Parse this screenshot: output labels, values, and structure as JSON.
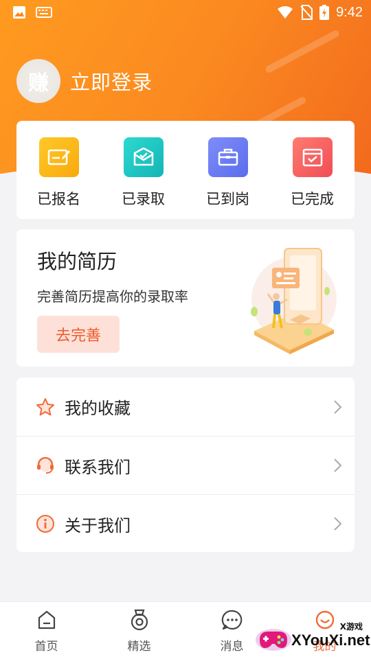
{
  "status_bar": {
    "time": "9:42",
    "icons": [
      "image-icon",
      "keyboard-icon",
      "wifi-icon",
      "no-sim-icon",
      "battery-charging-icon"
    ]
  },
  "profile": {
    "avatar_text": "赚",
    "login_label": "立即登录"
  },
  "status_items": [
    {
      "label": "已报名",
      "icon": "signup-icon",
      "color": "#fbb416"
    },
    {
      "label": "已录取",
      "icon": "admitted-icon",
      "color": "#1fc6c4"
    },
    {
      "label": "已到岗",
      "icon": "briefcase-icon",
      "color": "#6b7cf3"
    },
    {
      "label": "已完成",
      "icon": "completed-icon",
      "color": "#f45a5a"
    }
  ],
  "resume": {
    "title": "我的简历",
    "subtitle": "完善简历提高你的录取率",
    "button_label": "去完善"
  },
  "menu": [
    {
      "label": "我的收藏",
      "icon": "star-icon"
    },
    {
      "label": "联系我们",
      "icon": "headset-icon"
    },
    {
      "label": "关于我们",
      "icon": "info-icon"
    }
  ],
  "tabbar": [
    {
      "label": "首页",
      "icon": "home-icon"
    },
    {
      "label": "精选",
      "icon": "medal-icon"
    },
    {
      "label": "消息",
      "icon": "message-icon"
    },
    {
      "label": "我的",
      "icon": "profile-icon"
    }
  ],
  "watermark": {
    "small_text": "X游戏",
    "text": "XYouXi.net"
  },
  "colors": {
    "header_start": "#ff9a1f",
    "header_end": "#f26a1d",
    "accent": "#ef5a2b"
  }
}
